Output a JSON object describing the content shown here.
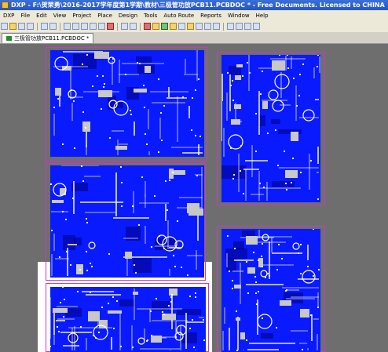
{
  "window": {
    "title": "DXP - F:\\贺荣勇\\2016-2017学年度第1学期\\教材\\三极管功放PCB11.PCBDOC * - Free Documents. Licensed to CHINA"
  },
  "menu": {
    "items": [
      "DXP",
      "File",
      "Edit",
      "View",
      "Project",
      "Place",
      "Design",
      "Tools",
      "Auto Route",
      "Reports",
      "Window",
      "Help"
    ]
  },
  "toolbar": {
    "icons": [
      "new-icon",
      "open-icon",
      "save-icon",
      "print-icon",
      "zoom-icon",
      "cut-icon",
      "copy-icon",
      "paste-icon",
      "select-icon",
      "move-icon",
      "undo-icon",
      "redo-icon",
      "wire-icon",
      "pad-icon",
      "via-icon",
      "fill-icon",
      "text-icon",
      "component-icon"
    ]
  },
  "document_tab": {
    "label": "三极管功放PCB11.PCBDOC *"
  },
  "colors": {
    "board_fill": "#0a1aff",
    "board_dark": "#000080",
    "trace": "#ffffff",
    "pad": "#c8c8c8",
    "outline": "#c040c0",
    "canvas": "#6e6e6e"
  }
}
